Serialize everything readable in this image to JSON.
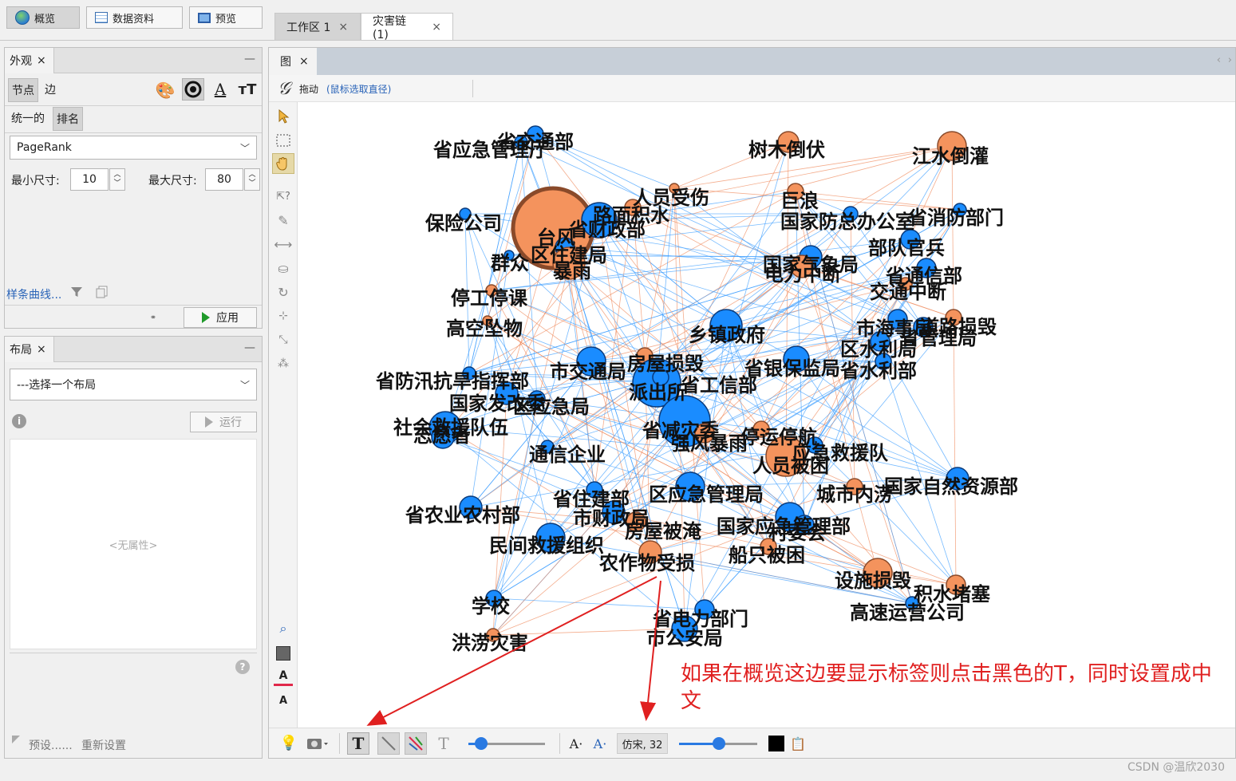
{
  "modes": {
    "overview": "概览",
    "data_lab": "数据资料",
    "preview": "预览"
  },
  "workspace_tabs": [
    {
      "label": "工作区 1",
      "close": "×"
    },
    {
      "label": "灾害链 (1)",
      "close": "×"
    }
  ],
  "appearance": {
    "title": "外观",
    "close": "×",
    "minimize": "—",
    "node_tab": "节点",
    "edge_tab": "边",
    "unified": "统一的",
    "ranking": "排名",
    "attribute": "PageRank",
    "min_size_label": "最小尺寸:",
    "min_size": "10",
    "max_size_label": "最大尺寸:",
    "max_size": "80",
    "spline_link": "样条曲线...",
    "apply": "应用"
  },
  "layout": {
    "title": "布局",
    "close": "×",
    "minimize": "—",
    "select_placeholder": "---选择一个布局",
    "run": "运行",
    "no_properties": "<无属性>",
    "presets": "预设......",
    "reset": "重新设置"
  },
  "graph": {
    "tab_label": "图",
    "close": "×",
    "drag_label": "拖动",
    "drag_hint": "(鼠标选取直径)",
    "font_display": "仿宋, 32",
    "nodes": [
      {
        "label": "省应急管理厅",
        "c": "b"
      },
      {
        "label": "省交通部",
        "c": "b"
      },
      {
        "label": "树木倒伏",
        "c": "o"
      },
      {
        "label": "江水倒灌",
        "c": "o"
      },
      {
        "label": "人员受伤",
        "c": "o"
      },
      {
        "label": "巨浪",
        "c": "o"
      },
      {
        "label": "保险公司",
        "c": "b"
      },
      {
        "label": "台风",
        "c": "o"
      },
      {
        "label": "省财政部",
        "c": "b"
      },
      {
        "label": "路面积水",
        "c": "o"
      },
      {
        "label": "国家防总办公室",
        "c": "b"
      },
      {
        "label": "省消防部门",
        "c": "b"
      },
      {
        "label": "部队官兵",
        "c": "b"
      },
      {
        "label": "群众",
        "c": "b"
      },
      {
        "label": "区住建局",
        "c": "b"
      },
      {
        "label": "暴雨",
        "c": "o"
      },
      {
        "label": "国家气象局",
        "c": "b"
      },
      {
        "label": "电力中断",
        "c": "o"
      },
      {
        "label": "省通信部",
        "c": "b"
      },
      {
        "label": "交通中断",
        "c": "o"
      },
      {
        "label": "停工停课",
        "c": "o"
      },
      {
        "label": "高空坠物",
        "c": "o"
      },
      {
        "label": "乡镇政府",
        "c": "b"
      },
      {
        "label": "市海事局",
        "c": "b"
      },
      {
        "label": "道路损毁",
        "c": "o"
      },
      {
        "label": "区水利局",
        "c": "b"
      },
      {
        "label": "省管理局",
        "c": "b"
      },
      {
        "label": "省防汛抗旱指挥部",
        "c": "b"
      },
      {
        "label": "市交通局",
        "c": "b"
      },
      {
        "label": "房屋损毁",
        "c": "o"
      },
      {
        "label": "派出所",
        "c": "b"
      },
      {
        "label": "省工信部",
        "c": "b"
      },
      {
        "label": "省银保监局",
        "c": "b"
      },
      {
        "label": "省水利部",
        "c": "b"
      },
      {
        "label": "国家发改委",
        "c": "b"
      },
      {
        "label": "区应急局",
        "c": "b"
      },
      {
        "label": "社会救援队伍",
        "c": "b"
      },
      {
        "label": "志愿者",
        "c": "b"
      },
      {
        "label": "省减灾委",
        "c": "b"
      },
      {
        "label": "强风暴雨",
        "c": "o"
      },
      {
        "label": "停运停航",
        "c": "o"
      },
      {
        "label": "人员被困",
        "c": "o"
      },
      {
        "label": "应急救援队",
        "c": "b"
      },
      {
        "label": "通信企业",
        "c": "b"
      },
      {
        "label": "城市内涝",
        "c": "o"
      },
      {
        "label": "国家自然资源部",
        "c": "b"
      },
      {
        "label": "省农业农村部",
        "c": "b"
      },
      {
        "label": "省住建部",
        "c": "b"
      },
      {
        "label": "区应急管理局",
        "c": "b"
      },
      {
        "label": "市财政局",
        "c": "b"
      },
      {
        "label": "房屋被淹",
        "c": "o"
      },
      {
        "label": "国家应急管理部",
        "c": "b"
      },
      {
        "label": "村委会",
        "c": "b"
      },
      {
        "label": "民间救援组织",
        "c": "b"
      },
      {
        "label": "船只被困",
        "c": "o"
      },
      {
        "label": "农作物受损",
        "c": "o"
      },
      {
        "label": "设施损毁",
        "c": "o"
      },
      {
        "label": "积水堵塞",
        "c": "o"
      },
      {
        "label": "学校",
        "c": "b"
      },
      {
        "label": "省电力部门",
        "c": "b"
      },
      {
        "label": "高速运营公司",
        "c": "b"
      },
      {
        "label": "市公安局",
        "c": "b"
      },
      {
        "label": "洪涝灾害",
        "c": "o"
      }
    ]
  },
  "annotation": "如果在概览这边要显示标签则点击黑色的T，同时设置成中文",
  "watermark": "CSDN @温欣2030",
  "colors": {
    "node_blue": "#1a8cff",
    "node_orange": "#f4935d",
    "edge_blue": "#3b9cff",
    "edge_orange": "#f08a5d",
    "annotation_red": "#e02020"
  }
}
